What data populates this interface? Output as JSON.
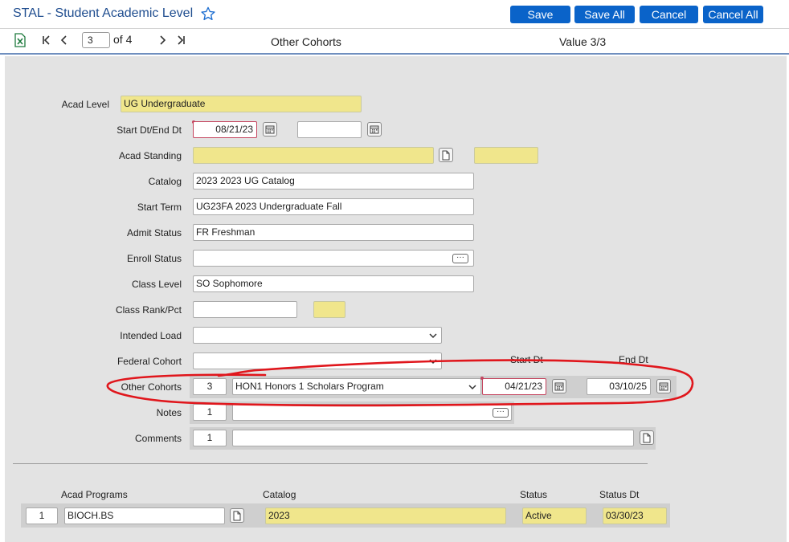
{
  "header": {
    "title": "STAL - Student Academic Level",
    "save_label": "Save",
    "save_all_label": "Save All",
    "cancel_label": "Cancel",
    "cancel_all_label": "Cancel All"
  },
  "nav": {
    "record_value": "3",
    "record_total": "of 4",
    "section_title": "Other Cohorts",
    "value_indicator": "Value 3/3"
  },
  "form": {
    "acad_level": {
      "label": "Acad Level",
      "value": "UG Undergraduate"
    },
    "start_end_dt": {
      "label": "Start Dt/End Dt",
      "start": "08/21/23",
      "end": ""
    },
    "acad_standing": {
      "label": "Acad Standing",
      "value": "",
      "extra": ""
    },
    "catalog": {
      "label": "Catalog",
      "value": "2023 2023 UG Catalog"
    },
    "start_term": {
      "label": "Start Term",
      "value": "UG23FA 2023 Undergraduate Fall"
    },
    "admit_status": {
      "label": "Admit Status",
      "value": "FR Freshman"
    },
    "enroll_status": {
      "label": "Enroll Status",
      "value": ""
    },
    "class_level": {
      "label": "Class Level",
      "value": "SO Sophomore"
    },
    "class_rank": {
      "label": "Class Rank/Pct",
      "rank": "",
      "pct": ""
    },
    "intended_load": {
      "label": "Intended Load",
      "value": ""
    },
    "federal_cohort": {
      "label": "Federal Cohort",
      "value": ""
    },
    "other_cohorts": {
      "label": "Other Cohorts",
      "start_dt_header": "Start Dt",
      "end_dt_header": "End Dt",
      "index": "3",
      "value": "HON1 Honors 1 Scholars Program",
      "start_dt": "04/21/23",
      "end_dt": "03/10/25"
    },
    "notes": {
      "label": "Notes",
      "index": "1",
      "value": ""
    },
    "comments": {
      "label": "Comments",
      "index": "1",
      "value": ""
    }
  },
  "programs": {
    "headers": {
      "program": "Acad Programs",
      "catalog": "Catalog",
      "status": "Status",
      "status_dt": "Status Dt"
    },
    "rows": [
      {
        "index": "1",
        "program": "BIOCH.BS",
        "catalog": "2023",
        "status": "Active",
        "status_dt": "03/30/23"
      }
    ]
  },
  "colors": {
    "accent": "#0a63c9",
    "title": "#1f4d8f",
    "readonly_field": "#f0e68c",
    "required_border": "#c4435d",
    "annotation": "#e0161c"
  }
}
